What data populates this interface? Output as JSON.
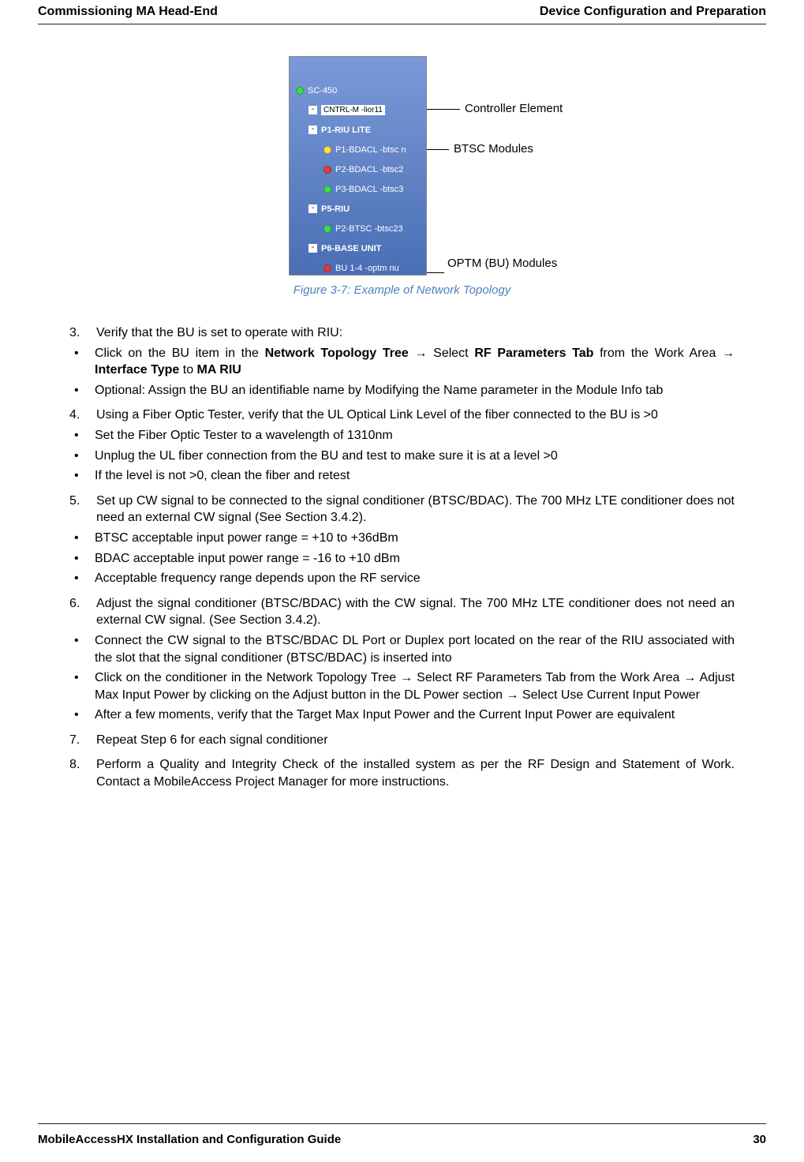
{
  "header": {
    "left": "Commissioning MA Head-End",
    "right": "Device Configuration and Preparation"
  },
  "topology": {
    "root": "SC-450",
    "controller_chip": "CNTRL-M -lior11",
    "riu_lite": "P1-RIU LITE",
    "bdacl1": "P1-BDACL -btsc n",
    "bdacl2": "P2-BDACL -btsc2",
    "bdacl3": "P3-BDACL -btsc3",
    "p5riu": "P5-RIU",
    "p2btsc": "P2-BTSC -btsc23",
    "p6base": "P6-BASE UNIT",
    "bu14": "BU 1-4 -optm nu"
  },
  "labels": {
    "controller": "Controller Element",
    "btsc": "BTSC Modules",
    "optm": "OPTM (BU) Modules"
  },
  "caption": "Figure 3-7: Example of Network Topology",
  "steps": {
    "s3": {
      "n": "3.",
      "text": "Verify that the BU is set to operate with RIU:",
      "b1a": "Click on the BU item in the ",
      "b1b": "Network Topology Tree",
      "b1c": " Select ",
      "b1d": "RF Parameters Tab",
      "b1e": " from the Work Area ",
      "b1f": "Interface Type",
      "b1g": " to ",
      "b1h": "MA RIU",
      "b2": "Optional: Assign the BU an identifiable name by Modifying the Name parameter in the Module Info tab"
    },
    "s4": {
      "n": "4.",
      "text": "Using a Fiber Optic Tester, verify that the UL Optical Link Level of the fiber connected to the BU is >0",
      "b1": "Set the Fiber Optic Tester to a wavelength of 1310nm",
      "b2": "Unplug the UL fiber connection from the BU and test to make sure it is at a level >0",
      "b3": "If the level is not >0, clean the fiber and retest"
    },
    "s5": {
      "n": "5.",
      "text": "Set up CW signal to be connected to the signal conditioner (BTSC/BDAC). The 700 MHz LTE conditioner does not need an external CW signal (See Section 3.4.2).",
      "b1": "BTSC acceptable input power range = +10 to +36dBm",
      "b2": "BDAC acceptable input power range = -16 to +10 dBm",
      "b3": "Acceptable frequency range depends upon the RF service"
    },
    "s6": {
      "n": "6.",
      "text": "Adjust the signal conditioner (BTSC/BDAC) with the CW signal. The 700 MHz LTE conditioner does not need an external CW signal. (See Section 3.4.2).",
      "b1": "Connect the CW signal to the BTSC/BDAC DL Port or Duplex port located on the rear of the RIU associated with the slot that the signal conditioner (BTSC/BDAC) is inserted into",
      "b2a": "Click on the conditioner in the Network Topology Tree ",
      "b2b": " Select RF Parameters Tab from the Work Area ",
      "b2c": " Adjust Max Input Power by clicking on the Adjust button in the DL Power section ",
      "b2d": " Select Use Current Input Power",
      "b3": "After a few moments, verify that the Target Max Input Power and the Current Input Power are equivalent"
    },
    "s7": {
      "n": "7.",
      "text": "Repeat Step 6 for each signal conditioner"
    },
    "s8": {
      "n": "8.",
      "text": "Perform a Quality and Integrity Check of the installed system as per the RF Design and Statement of Work.  Contact a MobileAccess Project Manager for more instructions."
    }
  },
  "footer": {
    "left": "MobileAccessHX Installation and Configuration Guide",
    "right": "30"
  }
}
